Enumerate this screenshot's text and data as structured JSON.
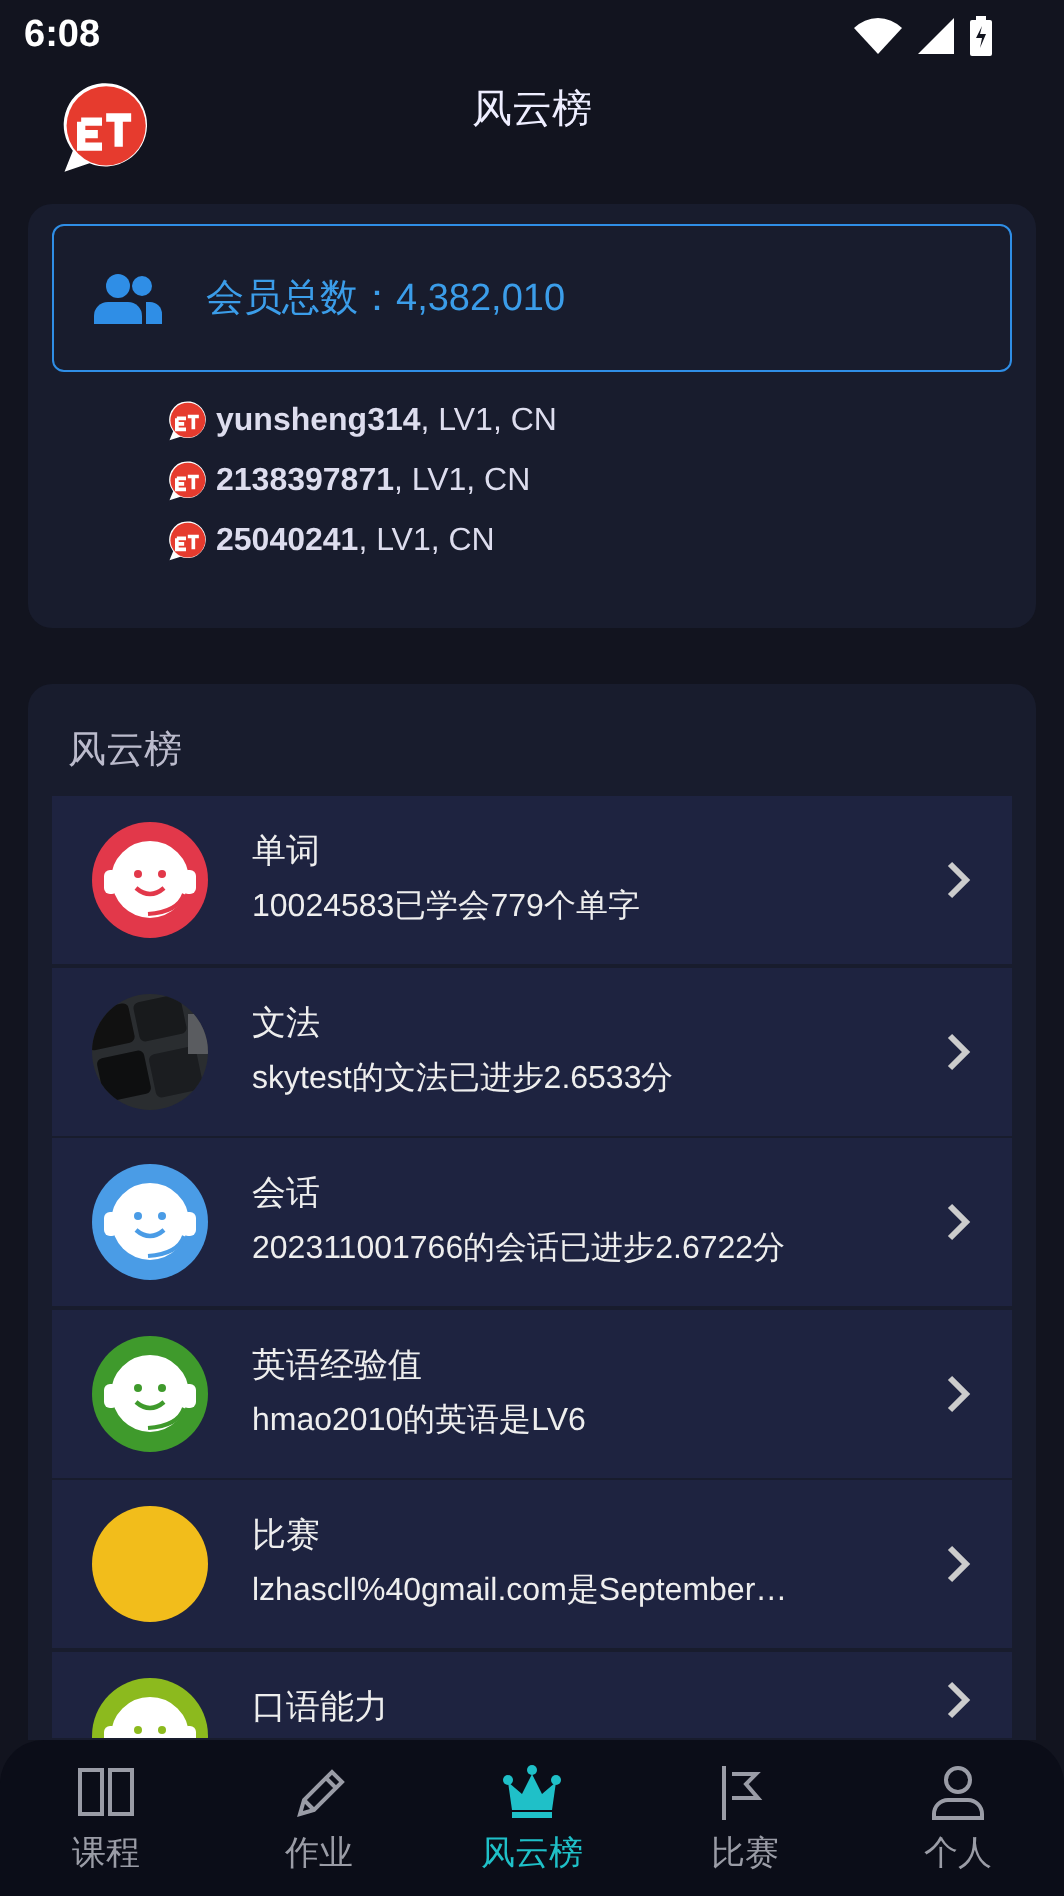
{
  "status_bar": {
    "time": "6:08"
  },
  "header": {
    "title": "风云榜"
  },
  "members": {
    "label": "会员总数：4,382,010",
    "recent": [
      "**yunsheng314**, LV1, CN",
      "**2138397871**, LV1, CN",
      "**25040241**, LV1, CN"
    ]
  },
  "leaderboard": {
    "title": "风云榜",
    "rows": [
      {
        "title": "单词",
        "subtitle": "10024583已学会779个单字",
        "avatar": {
          "kind": "headset",
          "color": "#e2384a"
        }
      },
      {
        "title": "文法",
        "subtitle": "skytest的文法已进步2.6533分"
      },
      {
        "title": "会话",
        "subtitle": "202311001766的会话已进步2.6722分",
        "avatar": {
          "kind": "headset",
          "color": "#4a9ce6"
        }
      },
      {
        "title": "英语经验值",
        "subtitle": "hmao2010的英语是LV6",
        "avatar": {
          "kind": "headset",
          "color": "#3f9a2c"
        }
      },
      {
        "title": "比赛",
        "subtitle": "lzhascll%40gmail.com是September…",
        "avatar": {
          "kind": "plain",
          "color": "#f2bd1b"
        }
      },
      {
        "title": "口语能力",
        "avatar": {
          "kind": "headset",
          "color": "#8cba1e"
        }
      }
    ]
  },
  "nav": [
    {
      "label": "课程",
      "selected": false
    },
    {
      "label": "作业",
      "selected": false
    },
    {
      "label": "风云榜",
      "selected": true
    },
    {
      "label": "比赛",
      "selected": false
    },
    {
      "label": "个人",
      "selected": false
    }
  ]
}
